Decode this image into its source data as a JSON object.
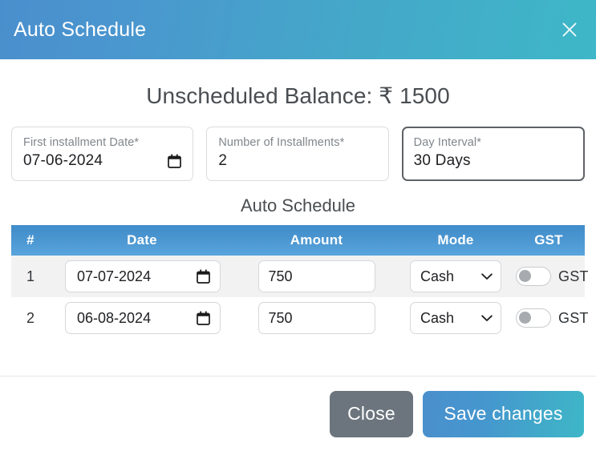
{
  "header": {
    "title": "Auto Schedule",
    "close_icon": "close-icon"
  },
  "balance": {
    "text": "Unscheduled Balance: ₹ 1500"
  },
  "fields": [
    {
      "name": "first-installment-date",
      "label": "First installment Date*",
      "value": "07-06-2024",
      "icon": "calendar-icon",
      "focused": false
    },
    {
      "name": "number-of-installments",
      "label": "Number of Installments*",
      "value": "2",
      "icon": "",
      "focused": false
    },
    {
      "name": "day-interval",
      "label": "Day Interval*",
      "value": "30 Days",
      "icon": "",
      "focused": true
    }
  ],
  "table": {
    "caption": "Auto Schedule",
    "columns": [
      "#",
      "Date",
      "Amount",
      "Mode",
      "GST"
    ],
    "rows": [
      {
        "num": "1",
        "date": "07-07-2024",
        "amount": "750",
        "mode": "Cash",
        "gst_label": "GST",
        "gst_on": false
      },
      {
        "num": "2",
        "date": "06-08-2024",
        "amount": "750",
        "mode": "Cash",
        "gst_label": "GST",
        "gst_on": false
      }
    ],
    "mode_options": [
      "Cash"
    ]
  },
  "footer": {
    "close_label": "Close",
    "save_label": "Save changes"
  },
  "colors": {
    "gradient_start": "#4a8fcd",
    "gradient_end": "#3eb7c8",
    "header_table_blue": "#4a95cf",
    "close_button": "#6c757d",
    "row_stripe": "#f2f2f2"
  }
}
